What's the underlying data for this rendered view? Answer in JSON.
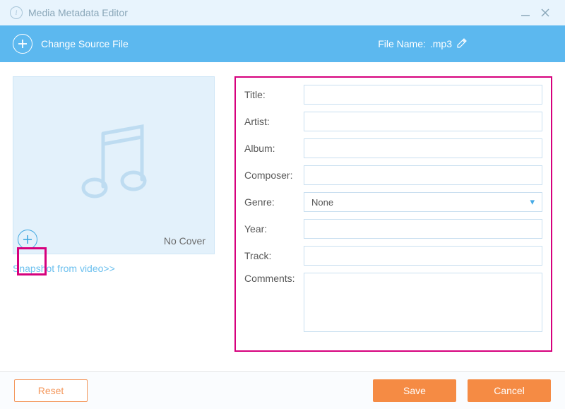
{
  "titlebar": {
    "title": "Media Metadata Editor"
  },
  "header": {
    "change_source": "Change Source File",
    "file_name_label": "File Name:",
    "file_name_value": ".mp3"
  },
  "cover": {
    "no_cover_label": "No Cover",
    "snapshot_link": "Snapshot from video>>"
  },
  "form": {
    "title": {
      "label": "Title:",
      "value": ""
    },
    "artist": {
      "label": "Artist:",
      "value": ""
    },
    "album": {
      "label": "Album:",
      "value": ""
    },
    "composer": {
      "label": "Composer:",
      "value": ""
    },
    "genre": {
      "label": "Genre:",
      "value": "None"
    },
    "year": {
      "label": "Year:",
      "value": ""
    },
    "track": {
      "label": "Track:",
      "value": ""
    },
    "comments": {
      "label": "Comments:",
      "value": ""
    }
  },
  "footer": {
    "reset": "Reset",
    "save": "Save",
    "cancel": "Cancel"
  }
}
